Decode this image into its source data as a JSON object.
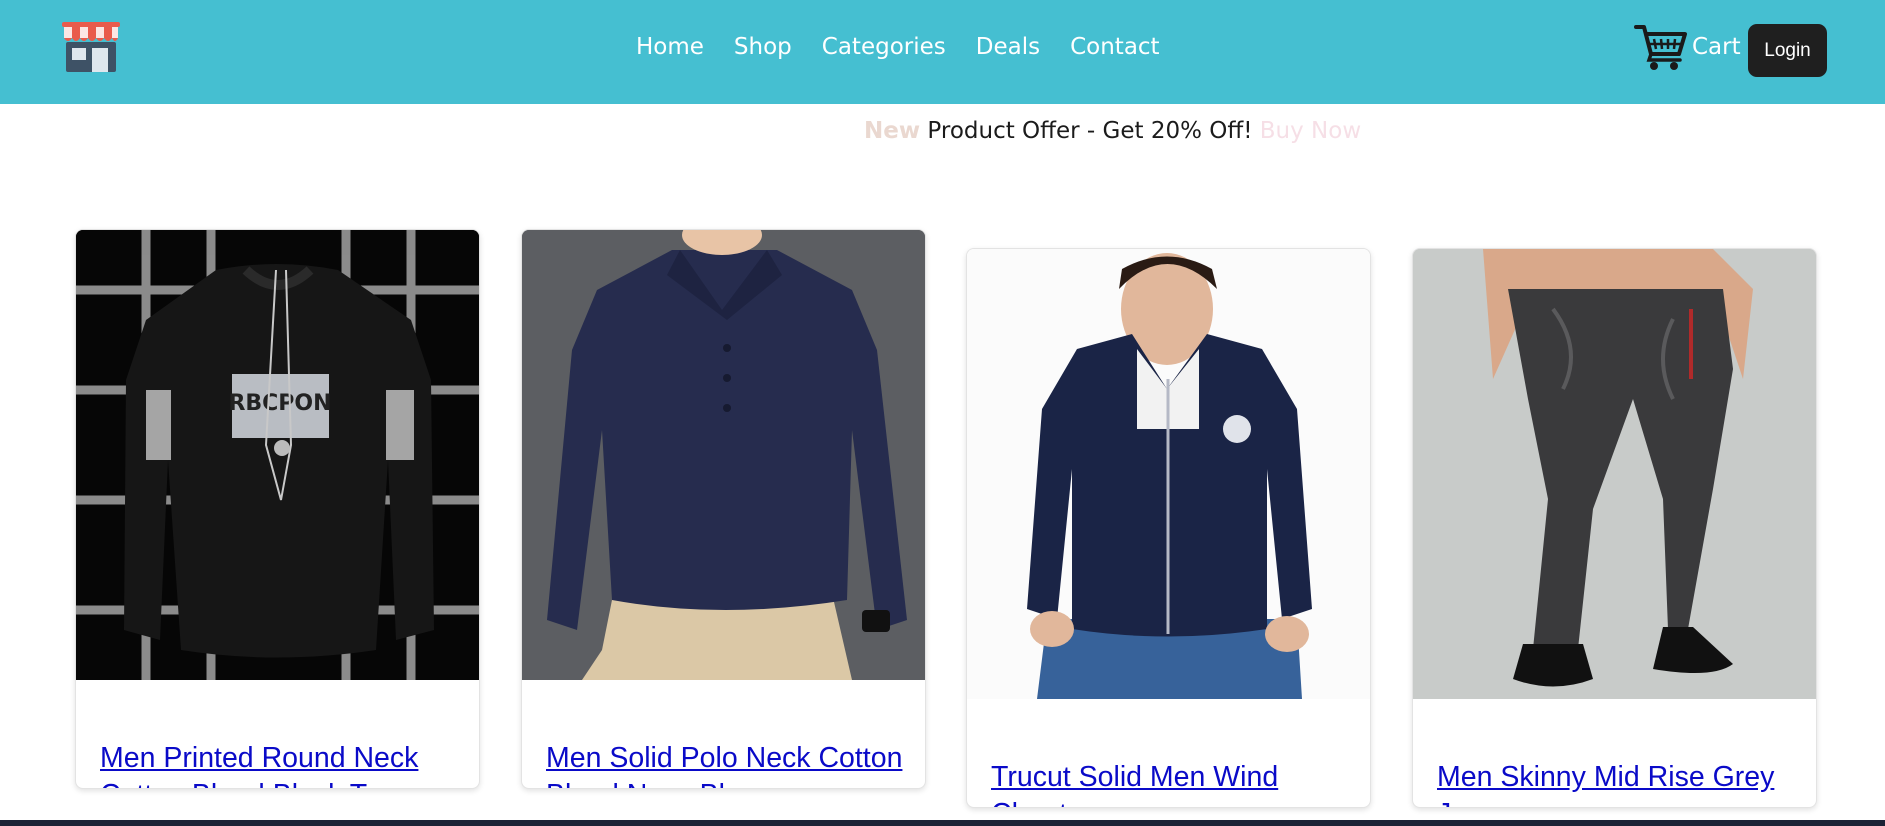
{
  "navbar": {
    "logo_icon": "store-icon",
    "links": [
      "Home",
      "Shop",
      "Categories",
      "Deals",
      "Contact"
    ],
    "cart_icon": "shopping-cart-icon",
    "cart_label": "Cart",
    "login_label": "Login"
  },
  "offer": {
    "prefix": "New",
    "text": "Product Offer - Get 20% Off!",
    "suffix": "Buy Now"
  },
  "products": [
    {
      "title": "Men Printed Round Neck Cotton Blend Black T-",
      "image": "black-sweatshirt-image",
      "print_text": "RBCPON"
    },
    {
      "title": "Men Solid Polo Neck Cotton Blend Navy Blue",
      "image": "navy-polo-image"
    },
    {
      "title": "Trucut Solid Men Wind Cheater",
      "image": "navy-jacket-image"
    },
    {
      "title": "Men Skinny Mid Rise Grey Jeans",
      "image": "grey-jeans-image"
    }
  ],
  "colors": {
    "navbar": "#45bfd1",
    "link": "#0a0ac8",
    "login_button": "#1f1f1f"
  }
}
